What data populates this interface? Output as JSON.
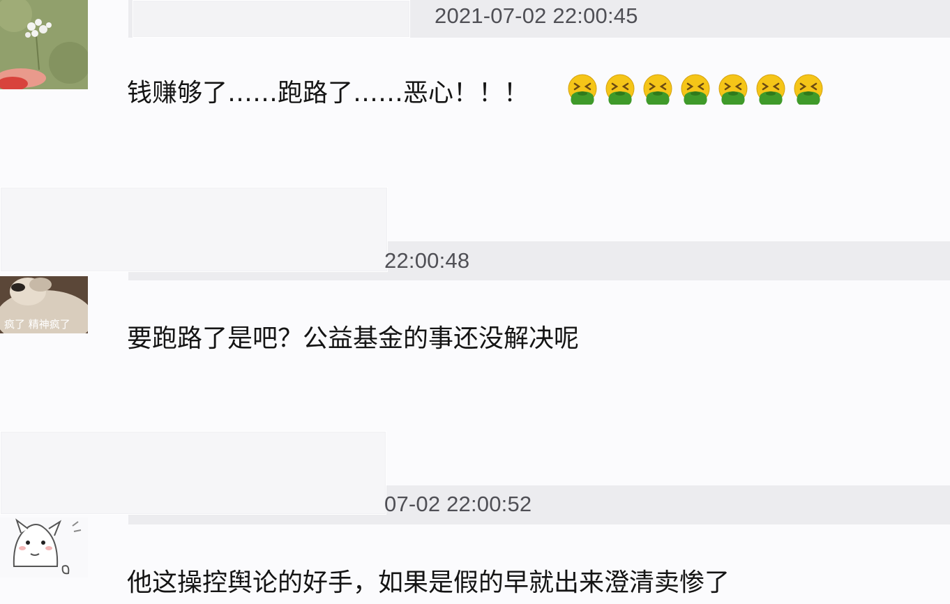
{
  "comments": [
    {
      "timestamp": "2021-07-02 22:00:45",
      "text": "钱赚够了……跑路了……恶心！！！",
      "emoji_count": 7,
      "emoji_icon": "vomiting-face-icon",
      "avatar_icon": "flower-avatar"
    },
    {
      "timestamp": "22:00:48",
      "text": "要跑路了是吧？公益基金的事还没解决呢",
      "avatar_icon": "dog-avatar",
      "avatar_caption": "疯了 精神疯了"
    },
    {
      "timestamp": "07-02 22:00:52",
      "text": "他这操控舆论的好手，如果是假的早就出来澄清卖惨了",
      "avatar_icon": "cartoon-cat-avatar"
    }
  ],
  "colors": {
    "background": "#fbfbfd",
    "timestamp_strip": "#ececef",
    "timestamp_text": "#4f4f55",
    "comment_text": "#141414",
    "emoji_face": "#f5c518",
    "emoji_vomit": "#3f9a2a"
  }
}
